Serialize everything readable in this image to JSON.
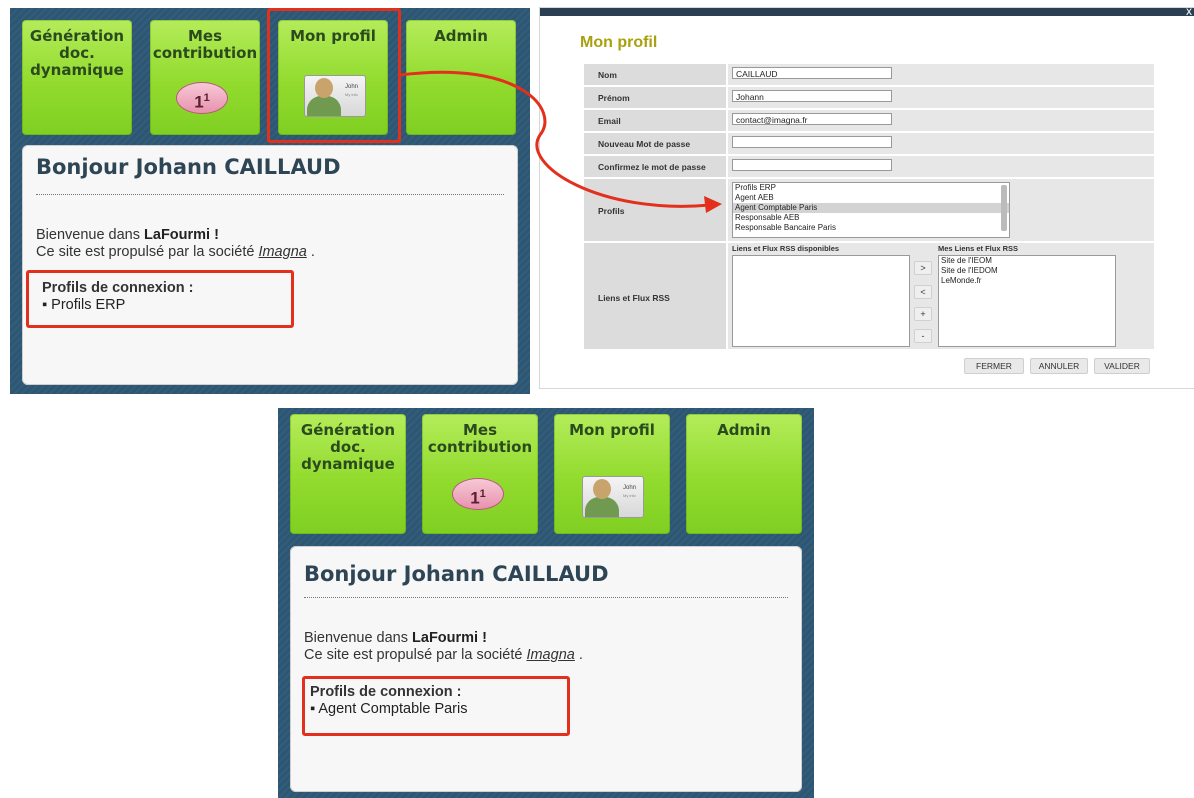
{
  "dashboard": {
    "tiles": [
      {
        "label": "Génération\ndoc.\ndynamique"
      },
      {
        "label": "Mes\ncontribution"
      },
      {
        "label": "Mon profil"
      },
      {
        "label": "Admin"
      }
    ],
    "bubble_count": "1",
    "bubble_sup": "1",
    "id_card_name": "John",
    "id_card_info": "My info",
    "greeting": "Bonjour Johann CAILLAUD",
    "welcome_prefix": "Bienvenue dans",
    "brand": "LaFourmi !",
    "powered_prefix": "Ce site est propulsé par la société",
    "company": "Imagna",
    "powered_suffix": " .",
    "profiles_title": "Profils de connexion :"
  },
  "before": {
    "profile_item": "Profils ERP"
  },
  "after": {
    "profile_item": "Agent Comptable Paris"
  },
  "dialog": {
    "title": "Mon profil",
    "close_glyph": "x",
    "fields": {
      "nom": {
        "label": "Nom",
        "value": "CAILLAUD"
      },
      "prenom": {
        "label": "Prénom",
        "value": "Johann"
      },
      "email": {
        "label": "Email",
        "value": "contact@imagna.fr"
      },
      "new_password": {
        "label": "Nouveau Mot de passe",
        "value": ""
      },
      "confirm_password": {
        "label": "Confirmez le mot de passe",
        "value": ""
      }
    },
    "profils": {
      "label": "Profils",
      "options": [
        "Profils ERP",
        "Agent AEB",
        "Agent Comptable Paris",
        "Responsable AEB",
        "Responsable Bancaire Paris"
      ],
      "selected": "Agent Comptable Paris"
    },
    "rss": {
      "label": "Liens et Flux RSS",
      "available_header": "Liens et Flux RSS disponibles",
      "mine_header": "Mes Liens et Flux RSS",
      "available_items": [],
      "mine_items": [
        "Site de l'IEOM",
        "Site de l'IEDOM",
        "LeMonde.fr"
      ],
      "move_buttons": [
        ">",
        "<",
        "+",
        "-"
      ]
    },
    "buttons": {
      "close": "FERMER",
      "cancel": "ANNULER",
      "submit": "VALIDER"
    }
  },
  "colors": {
    "accent_red": "#e2301c",
    "tile_green": "#92db2e",
    "panel_blue": "#2c5673",
    "title_olive": "#a9a00d"
  }
}
